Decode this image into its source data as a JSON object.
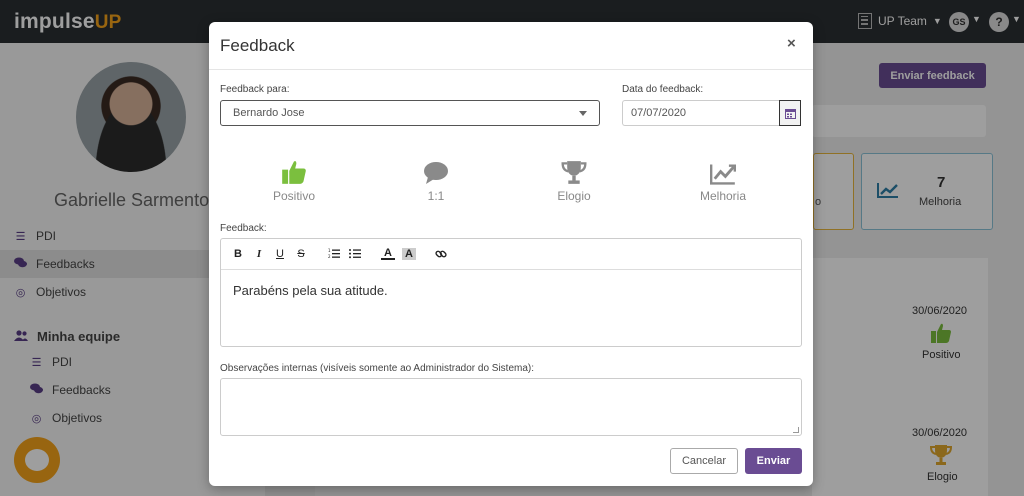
{
  "topbar": {
    "brand_main": "impulse",
    "brand_accent": "UP",
    "team_label": "UP Team",
    "user_initials": "GS",
    "help_label": "?"
  },
  "sidebar": {
    "user_name": "Gabrielle Sarmento",
    "items": [
      {
        "label": "PDI",
        "icon": "list-icon"
      },
      {
        "label": "Feedbacks",
        "icon": "comments-icon"
      },
      {
        "label": "Objetivos",
        "icon": "target-icon"
      }
    ],
    "team_heading": "Minha equipe",
    "team_items": [
      {
        "label": "PDI",
        "icon": "list-icon"
      },
      {
        "label": "Feedbacks",
        "icon": "comments-icon"
      },
      {
        "label": "Objetivos",
        "icon": "target-icon"
      }
    ]
  },
  "main": {
    "send_feedback_label": "Enviar feedback",
    "card_a_tail": "o",
    "card_b": {
      "value": "7",
      "label": "Melhoria"
    },
    "entries": [
      {
        "date": "30/06/2020",
        "label": "Positivo",
        "icon": "thumbs-up-icon"
      },
      {
        "date": "30/06/2020",
        "label": "Elogio",
        "icon": "trophy-icon"
      }
    ]
  },
  "modal": {
    "title": "Feedback",
    "close_label": "×",
    "feedback_for_label": "Feedback para:",
    "feedback_for_value": "Bernardo Jose",
    "date_label": "Data do feedback:",
    "date_value": "07/07/2020",
    "types": [
      {
        "label": "Positivo",
        "icon": "thumbs-up-icon",
        "selected": true
      },
      {
        "label": "1:1",
        "icon": "speech-bubble-icon",
        "selected": false
      },
      {
        "label": "Elogio",
        "icon": "trophy-icon",
        "selected": false
      },
      {
        "label": "Melhoria",
        "icon": "trend-chart-icon",
        "selected": false
      }
    ],
    "feedback_label": "Feedback:",
    "toolbar": {
      "bold": "B",
      "italic": "I",
      "underline": "U",
      "strike": "S",
      "font_color": "A",
      "highlight": "A"
    },
    "feedback_text": "Parabéns pela sua atitude.",
    "observations_label": "Observações internas (visíveis somente ao Administrador do Sistema):",
    "observations_value": "",
    "cancel_label": "Cancelar",
    "submit_label": "Enviar"
  },
  "colors": {
    "topbar": "#2b2f33",
    "brand_accent": "#f5a31a",
    "primary": "#6a4c93",
    "positive": "#7bbf3e",
    "muted_icon": "#8a8a8a",
    "trophy": "#e0a82e"
  }
}
